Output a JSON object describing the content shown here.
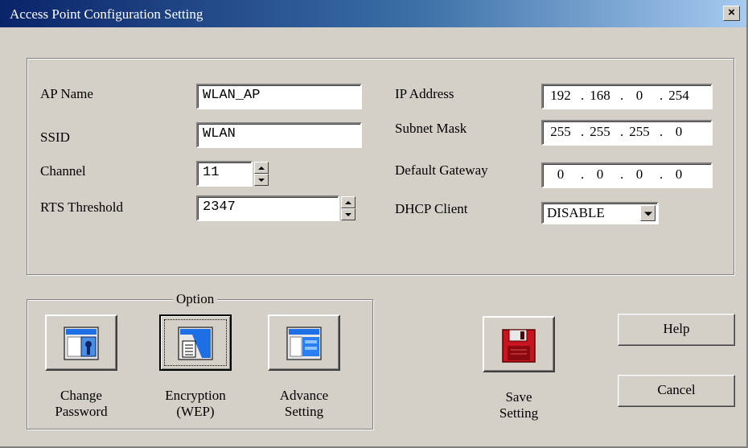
{
  "window": {
    "title": "Access Point Configuration Setting",
    "close_label": "×"
  },
  "settings": {
    "ap_name": {
      "label": "AP Name",
      "value": "WLAN_AP"
    },
    "ssid": {
      "label": "SSID",
      "value": "WLAN"
    },
    "channel": {
      "label": "Channel",
      "value": "11"
    },
    "rts_threshold": {
      "label": "RTS Threshold",
      "value": "2347"
    },
    "ip_address": {
      "label": "IP Address",
      "octets": [
        "192",
        "168",
        "0",
        "254"
      ]
    },
    "subnet_mask": {
      "label": "Subnet Mask",
      "octets": [
        "255",
        "255",
        "255",
        "0"
      ]
    },
    "default_gateway": {
      "label": "Default Gateway",
      "octets": [
        "0",
        "0",
        "0",
        "0"
      ]
    },
    "dhcp_client": {
      "label": "DHCP Client",
      "value": "DISABLE"
    }
  },
  "option": {
    "legend": "Option",
    "buttons": [
      {
        "icon": "change-password-icon",
        "caption_line1": "Change",
        "caption_line2": "Password"
      },
      {
        "icon": "encryption-icon",
        "caption_line1": "Encryption",
        "caption_line2": "(WEP)"
      },
      {
        "icon": "advance-setting-icon",
        "caption_line1": "Advance",
        "caption_line2": "Setting"
      }
    ]
  },
  "save": {
    "icon": "floppy-disk-icon",
    "caption_line1": "Save",
    "caption_line2": "Setting"
  },
  "actions": {
    "help_label": "Help",
    "cancel_label": "Cancel"
  },
  "colors": {
    "title_bar_start": "#0a246a",
    "title_bar_end": "#a6caf0",
    "face": "#d4d0c8",
    "save_icon": "#c8141e",
    "icon_blue": "#1e6ee6"
  }
}
